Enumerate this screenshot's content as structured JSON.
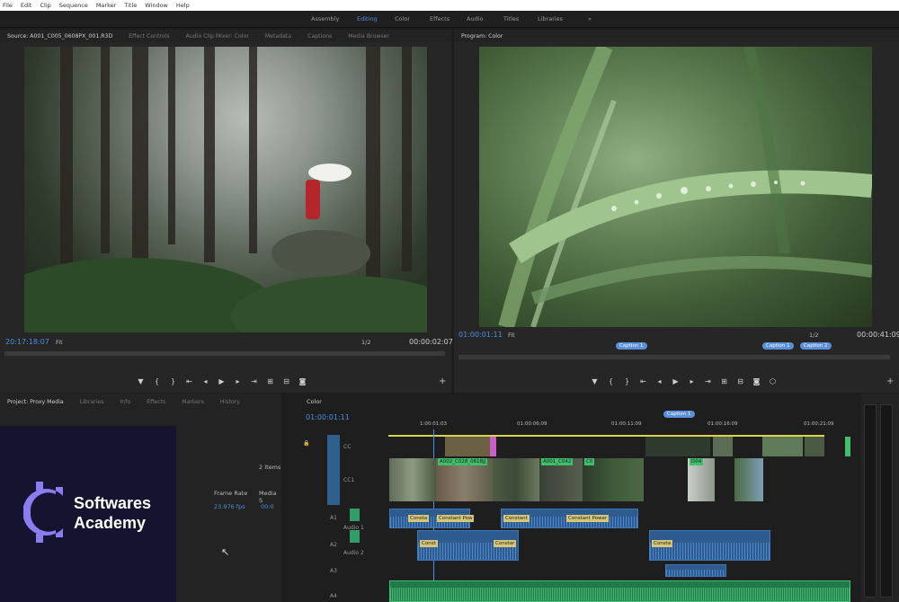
{
  "menu": [
    "File",
    "Edit",
    "Clip",
    "Sequence",
    "Marker",
    "Title",
    "Window",
    "Help"
  ],
  "workspaces": [
    {
      "label": "Assembly",
      "active": false
    },
    {
      "label": "Editing",
      "active": true
    },
    {
      "label": "Color",
      "active": false
    },
    {
      "label": "Effects",
      "active": false
    },
    {
      "label": "Audio",
      "active": false
    },
    {
      "label": "Titles",
      "active": false
    },
    {
      "label": "Libraries",
      "active": false
    }
  ],
  "workspace_more": "»",
  "source": {
    "tabs": [
      "Source: A001_C005_0608PX_001.R3D",
      "Effect Controls",
      "Audio Clip Mixer: Color",
      "Metadata",
      "Captions",
      "Media Browser"
    ],
    "timecode_in": "20:17:18:07",
    "fit": "Fit",
    "resolution": "1/2",
    "timecode_out": "00:00:02:07"
  },
  "program": {
    "tab": "Program: Color",
    "timecode_in": "01:00:01:11",
    "fit": "Fit",
    "resolution": "1/2",
    "timecode_out": "00:00:41:09",
    "captions": [
      "Caption 1",
      "Caption 1",
      "Caption 2"
    ]
  },
  "project": {
    "tabs": [
      "Project: Proxy Media",
      "Libraries",
      "Info",
      "Effects",
      "Markers",
      "History"
    ],
    "items_count": "2 Items",
    "col_frame_rate": "Frame Rate",
    "col_media": "Media S",
    "frame_rate_value": "23.976 fps",
    "media_value": "00:0"
  },
  "timeline": {
    "tab": "Color",
    "timecode": "01:00:01:11",
    "ruler": [
      "1:00:01:03",
      "01:00:06:09",
      "01:00:11:09",
      "01:00:16:09",
      "01:00:21:09"
    ],
    "caption_top": "Caption 1",
    "tracks": [
      "CC",
      "V2",
      "V1",
      "A1",
      "A2",
      "A3",
      "A4"
    ],
    "track_sub": [
      "CC1",
      "Audio 1",
      "Audio 2"
    ],
    "video_labels": [
      "A002_C028_0618JJ",
      "A001_C042",
      "C0",
      "D04"
    ],
    "audio_labels": [
      "Consta",
      "Constant Pow",
      "Constant",
      "Constant Power",
      "Const",
      "Constar",
      "Consta"
    ]
  },
  "brand": {
    "line1": "Softwares",
    "line2": "Academy",
    "color": "#8b7cf0"
  },
  "colors": {
    "accent": "#4a90e2",
    "background": "#1d1d1d",
    "audio_clip": "#2d5b8f",
    "audio_green": "#3fbf6b"
  }
}
